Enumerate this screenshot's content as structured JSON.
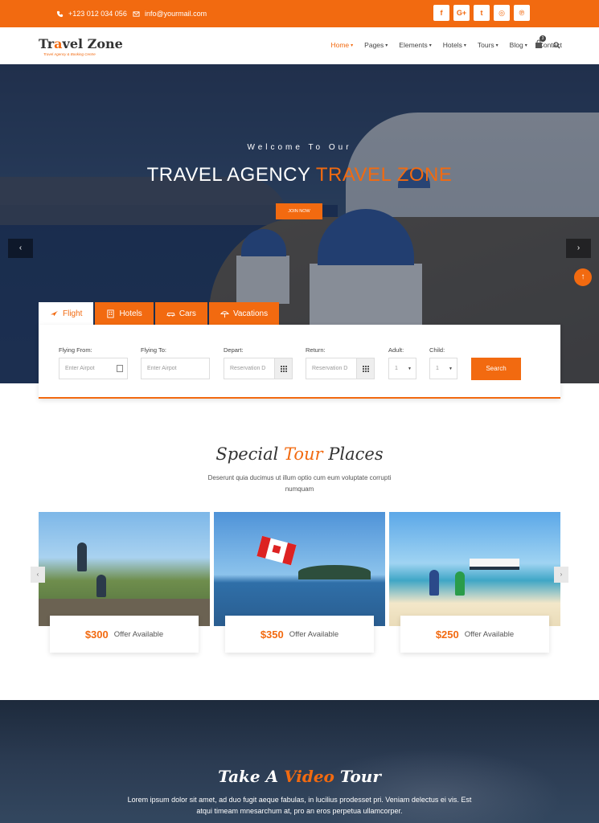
{
  "topbar": {
    "phone": "+123 012 034 056",
    "email": "info@yourmail.com",
    "socials": [
      "f",
      "G+",
      "t",
      "◎",
      "℗"
    ]
  },
  "logo": {
    "name_pre": "Tr",
    "name_o": "a",
    "name_post": "vel Zone",
    "tagline": "Travel Agency & Booking Centre"
  },
  "nav": {
    "items": [
      {
        "label": "Home",
        "caret": "▾"
      },
      {
        "label": "Pages",
        "caret": "▾"
      },
      {
        "label": "Elements",
        "caret": "▾"
      },
      {
        "label": "Hotels",
        "caret": "▾"
      },
      {
        "label": "Tours",
        "caret": "▾"
      },
      {
        "label": "Blog",
        "caret": "▾"
      },
      {
        "label": "Contact",
        "caret": ""
      }
    ],
    "cart_count": "3"
  },
  "hero": {
    "welcome": "Welcome To Our",
    "headline_main": "TRAVEL AGENCY ",
    "headline_accent": "TRAVEL ZONE",
    "join_label": "JOIN NOW",
    "prev": "‹",
    "next": "›",
    "up": "↑"
  },
  "booking": {
    "tabs": [
      "Flight",
      "Hotels",
      "Cars",
      "Vacations"
    ],
    "fields": {
      "from": {
        "label": "Flying From:",
        "placeholder": "Enter Airpot"
      },
      "to": {
        "label": "Flying To:",
        "placeholder": "Enter Airpot"
      },
      "depart": {
        "label": "Depart:",
        "placeholder": "Reservation D"
      },
      "return": {
        "label": "Return:",
        "placeholder": "Reservation D"
      },
      "adult": {
        "label": "Adult:",
        "value": "1"
      },
      "child": {
        "label": "Child:",
        "value": "1"
      }
    },
    "search_label": "Search"
  },
  "special": {
    "title_pre": "Special ",
    "title_accent": "Tour",
    "title_post": " Places",
    "subtitle": "Deserunt quia ducimus ut illum optio cum eum voluptate corrupti numquam",
    "cards": [
      {
        "price": "$300",
        "offer": "Offer Available"
      },
      {
        "price": "$350",
        "offer": "Offer Available"
      },
      {
        "price": "$250",
        "offer": "Offer Available"
      }
    ],
    "prev": "‹",
    "next": "›"
  },
  "video": {
    "title_pre": "Take A ",
    "title_accent": "Video",
    "title_post": " Tour",
    "text": "Lorem ipsum dolor sit amet, ad duo fugit aeque fabulas, in lucilius prodesset pri. Veniam delectus ei vis. Est atqui timeam mnesarchum at, pro an eros perpetua ullamcorper."
  },
  "colors": {
    "accent": "#f26a10"
  }
}
